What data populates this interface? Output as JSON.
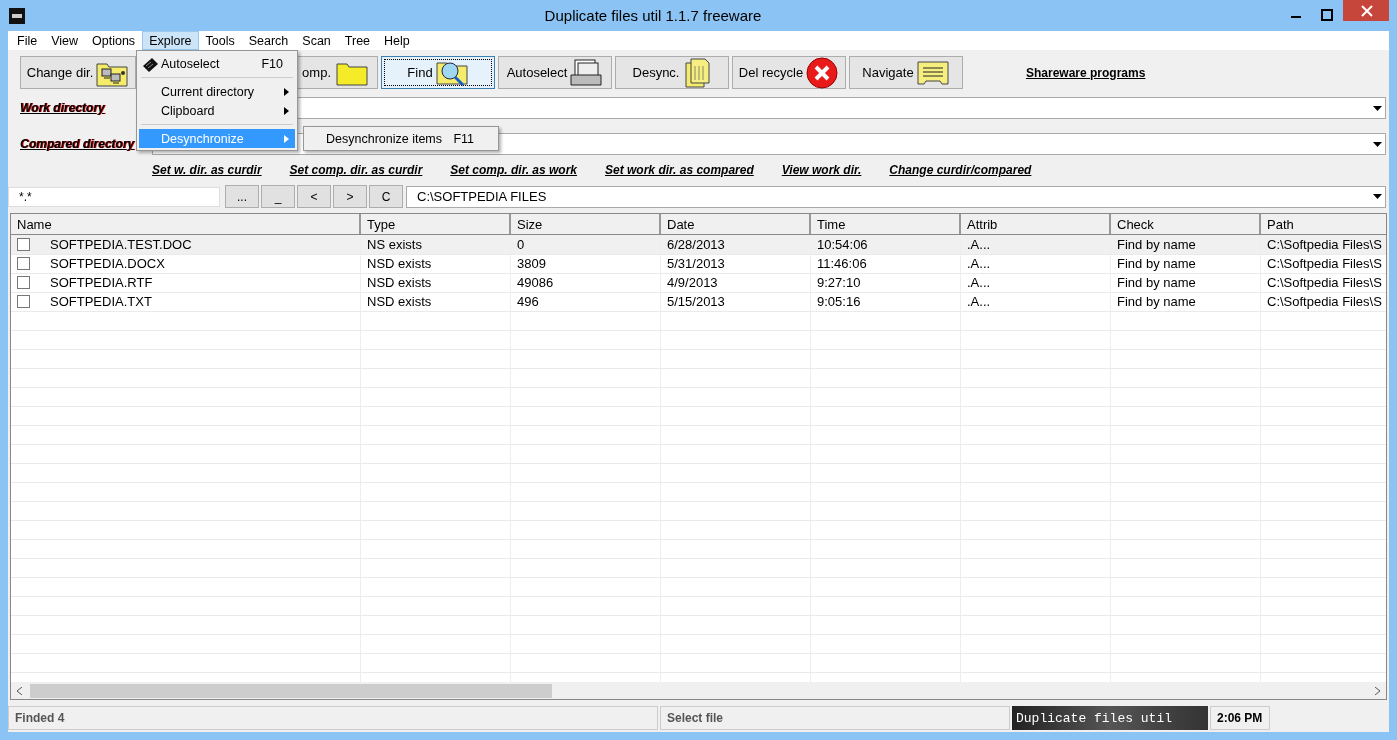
{
  "window": {
    "title": "Duplicate files util 1.1.7 freeware"
  },
  "menu_bar": [
    {
      "label": "File",
      "selected": false
    },
    {
      "label": "View",
      "selected": false
    },
    {
      "label": "Options",
      "selected": false
    },
    {
      "label": "Explore",
      "selected": true
    },
    {
      "label": "Tools",
      "selected": false
    },
    {
      "label": "Search",
      "selected": false
    },
    {
      "label": "Scan",
      "selected": false
    },
    {
      "label": "Tree",
      "selected": false
    },
    {
      "label": "Help",
      "selected": false
    }
  ],
  "explore_menu": [
    {
      "kind": "item",
      "label": "Autoselect",
      "shortcut": "F10",
      "submenu": false,
      "selected": false
    },
    {
      "kind": "separator"
    },
    {
      "kind": "item",
      "label": "Current directory",
      "submenu": true,
      "selected": false
    },
    {
      "kind": "item",
      "label": "Clipboard",
      "submenu": true,
      "selected": false
    },
    {
      "kind": "separator"
    },
    {
      "kind": "item",
      "label": "Desynchronize",
      "submenu": true,
      "selected": true
    }
  ],
  "submenu": [
    {
      "label": "Desynchronize items",
      "shortcut": "F11"
    }
  ],
  "toolbar": [
    {
      "kind": "change",
      "label": "Change dir.",
      "focused": false
    },
    {
      "kind": "folder",
      "label": "omp.",
      "focused": false
    },
    {
      "kind": "find",
      "label": "Find",
      "focused": true
    },
    {
      "kind": "tray",
      "label": "Autoselect",
      "focused": false
    },
    {
      "kind": "files",
      "label": "Desync.",
      "focused": false
    },
    {
      "kind": "delete",
      "label": "Del recycle",
      "focused": false
    },
    {
      "kind": "note",
      "label": "Navigate",
      "focused": false
    }
  ],
  "shareware_link": "Shareware programs",
  "directories": [
    {
      "label": "Work directory"
    },
    {
      "label": "Compared directory"
    }
  ],
  "links": [
    "Set w. dir. as curdir",
    "Set comp. dir. as curdir",
    "Set comp. dir. as work",
    "Set work dir. as compared",
    "View work dir.",
    "Change curdir/compared"
  ],
  "filter": {
    "value": "*.*"
  },
  "nav_buttons": [
    "...",
    "_",
    "<",
    ">",
    "C"
  ],
  "path_field": {
    "value": "C:\\SOFTPEDIA FILES"
  },
  "table": {
    "columns": [
      "Name",
      "Type",
      "Size",
      "Date",
      "Time",
      "Attrib",
      "Check",
      "Path"
    ],
    "rows": [
      {
        "selected": true,
        "checked": false,
        "cells": [
          "SOFTPEDIA.TEST.DOC",
          "NS exists",
          "0",
          "6/28/2013",
          "10:54:06",
          ".A...",
          "Find by name",
          "C:\\Softpedia Files\\S"
        ]
      },
      {
        "selected": false,
        "checked": false,
        "cells": [
          "SOFTPEDIA.DOCX",
          "NSD exists",
          "3809",
          "5/31/2013",
          "11:46:06",
          ".A...",
          "Find by name",
          "C:\\Softpedia Files\\S"
        ]
      },
      {
        "selected": false,
        "checked": false,
        "cells": [
          "SOFTPEDIA.RTF",
          "NSD exists",
          "49086",
          "4/9/2013",
          " 9:27:10",
          ".A...",
          "Find by name",
          "C:\\Softpedia Files\\S"
        ]
      },
      {
        "selected": false,
        "checked": false,
        "cells": [
          "SOFTPEDIA.TXT",
          "NSD exists",
          "496",
          "5/15/2013",
          " 9:05:16",
          ".A...",
          "Find by name",
          "C:\\Softpedia Files\\S"
        ]
      }
    ]
  },
  "status_bar": {
    "left": "Finded 4",
    "middle": "Select file",
    "banner": "Duplicate files util",
    "time": "2:06 PM"
  }
}
